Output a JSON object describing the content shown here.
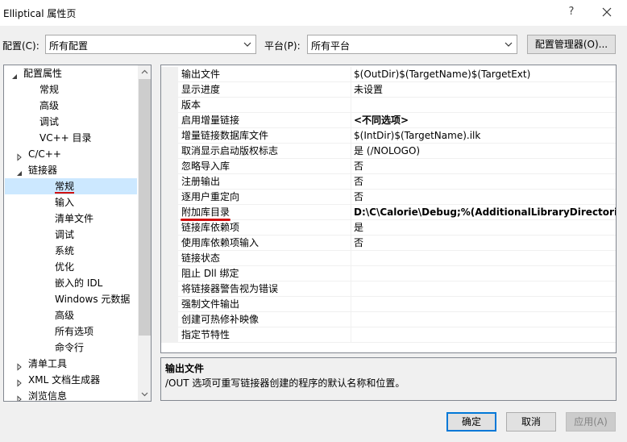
{
  "window": {
    "title": "Elliptical 属性页",
    "help_glyph": "?",
    "close_icon": "close-icon"
  },
  "config_bar": {
    "config_label": "配置(C):",
    "config_value": "所有配置",
    "platform_label": "平台(P):",
    "platform_value": "所有平台",
    "manager_button": "配置管理器(O)..."
  },
  "tree": {
    "items": [
      {
        "label": "配置属性",
        "expander": "expanded"
      },
      {
        "label": "常规",
        "expander": "none"
      },
      {
        "label": "高级",
        "expander": "none"
      },
      {
        "label": "调试",
        "expander": "none"
      },
      {
        "label": "VC++ 目录",
        "expander": "none"
      },
      {
        "label": "C/C++",
        "expander": "collapsed"
      },
      {
        "label": "链接器",
        "expander": "expanded"
      },
      {
        "label": "常规",
        "expander": "none",
        "selected": true
      },
      {
        "label": "输入",
        "expander": "none"
      },
      {
        "label": "清单文件",
        "expander": "none"
      },
      {
        "label": "调试",
        "expander": "none"
      },
      {
        "label": "系统",
        "expander": "none"
      },
      {
        "label": "优化",
        "expander": "none"
      },
      {
        "label": "嵌入的 IDL",
        "expander": "none"
      },
      {
        "label": "Windows 元数据",
        "expander": "none"
      },
      {
        "label": "高级",
        "expander": "none"
      },
      {
        "label": "所有选项",
        "expander": "none"
      },
      {
        "label": "命令行",
        "expander": "none"
      },
      {
        "label": "清单工具",
        "expander": "collapsed"
      },
      {
        "label": "XML 文档生成器",
        "expander": "collapsed"
      },
      {
        "label": "浏览信息",
        "expander": "collapsed"
      }
    ]
  },
  "properties": {
    "rows": [
      {
        "name": "输出文件",
        "value": "$(OutDir)$(TargetName)$(TargetExt)"
      },
      {
        "name": "显示进度",
        "value": "未设置"
      },
      {
        "name": "版本",
        "value": ""
      },
      {
        "name": "启用增量链接",
        "value": "<不同选项>",
        "bold": true
      },
      {
        "name": "增量链接数据库文件",
        "value": "$(IntDir)$(TargetName).ilk"
      },
      {
        "name": "取消显示启动版权标志",
        "value": "是 (/NOLOGO)"
      },
      {
        "name": "忽略导入库",
        "value": "否"
      },
      {
        "name": "注册输出",
        "value": "否"
      },
      {
        "name": "逐用户重定向",
        "value": "否"
      },
      {
        "name": "附加库目录",
        "value": "D:\\C\\Calorie\\Debug;%(AdditionalLibraryDirectories)",
        "bold": true,
        "underlined": true
      },
      {
        "name": "链接库依赖项",
        "value": "是"
      },
      {
        "name": "使用库依赖项输入",
        "value": "否"
      },
      {
        "name": "链接状态",
        "value": ""
      },
      {
        "name": "阻止 Dll 绑定",
        "value": ""
      },
      {
        "name": "将链接器警告视为错误",
        "value": ""
      },
      {
        "name": "强制文件输出",
        "value": ""
      },
      {
        "name": "创建可热修补映像",
        "value": ""
      },
      {
        "name": "指定节特性",
        "value": ""
      }
    ]
  },
  "description": {
    "title": "输出文件",
    "text": "/OUT 选项可重写链接器创建的程序的默认名称和位置。"
  },
  "buttons": {
    "ok": "确定",
    "cancel": "取消",
    "apply": "应用(A)"
  },
  "colors": {
    "selection": "#cce8ff",
    "annotation_underline": "#d01010"
  }
}
